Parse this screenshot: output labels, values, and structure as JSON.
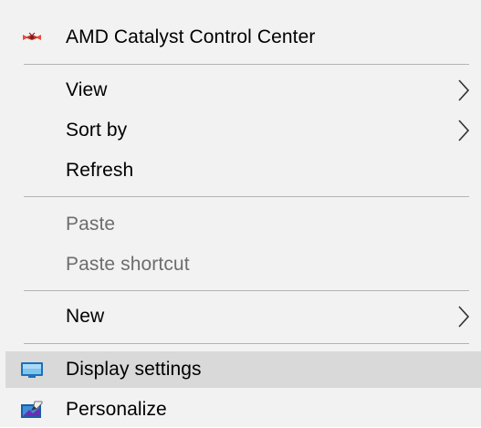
{
  "menu": {
    "items": [
      {
        "label": "AMD Catalyst Control Center",
        "icon": "amd-catalyst-icon",
        "enabled": true
      },
      {
        "label": "View",
        "submenu": true,
        "enabled": true
      },
      {
        "label": "Sort by",
        "submenu": true,
        "enabled": true
      },
      {
        "label": "Refresh",
        "enabled": true
      },
      {
        "label": "Paste",
        "enabled": false
      },
      {
        "label": "Paste shortcut",
        "enabled": false
      },
      {
        "label": "New",
        "submenu": true,
        "enabled": true
      },
      {
        "label": "Display settings",
        "icon": "display-settings-icon",
        "enabled": true,
        "highlighted": true
      },
      {
        "label": "Personalize",
        "icon": "personalize-icon",
        "enabled": true
      }
    ],
    "colors": {
      "background": "#f2f2f2",
      "highlight": "#d9d9d9",
      "separator": "#b3b3b3",
      "disabled_text": "#6d6d6d"
    }
  }
}
